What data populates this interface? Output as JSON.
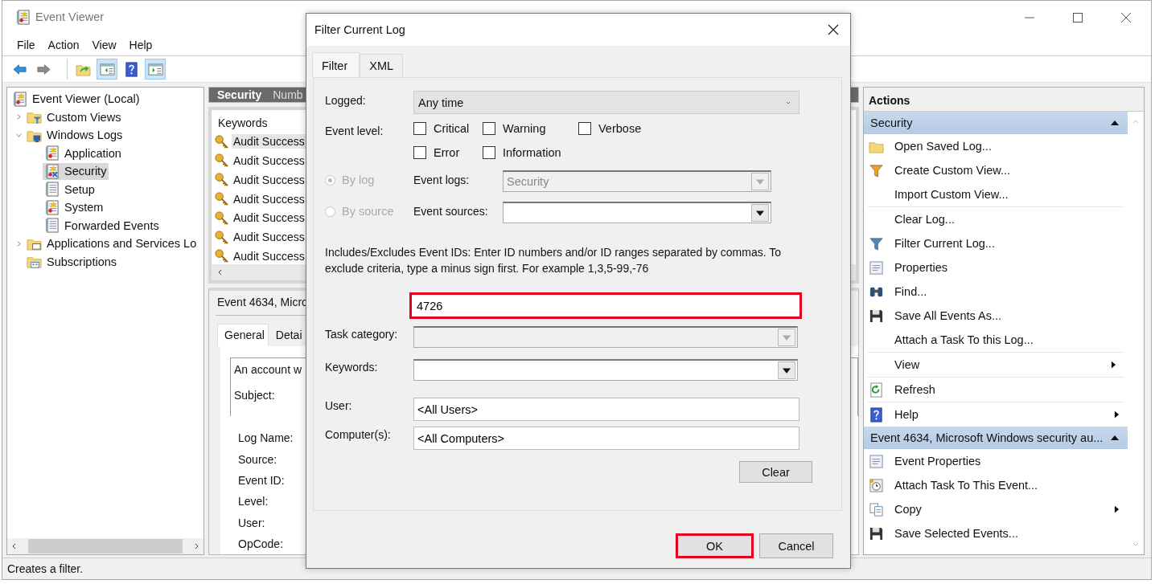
{
  "window": {
    "title": "Event Viewer"
  },
  "menu": [
    "File",
    "Action",
    "View",
    "Help"
  ],
  "toolbar": [
    {
      "kind": "back",
      "pressed": false
    },
    {
      "kind": "forward",
      "pressed": false
    },
    {
      "kind": "up",
      "pressed": false
    },
    {
      "kind": "tree",
      "pressed": true
    },
    {
      "kind": "help",
      "pressed": false
    },
    {
      "kind": "actions",
      "pressed": true
    }
  ],
  "tree": [
    {
      "label": "Event Viewer (Local)",
      "kind": "root",
      "selected": false,
      "children": [
        {
          "label": "Custom Views",
          "kind": "folder-filter",
          "expanded": false,
          "selected": false
        },
        {
          "label": "Windows Logs",
          "kind": "folder-logs",
          "expanded": true,
          "selected": false,
          "children": [
            {
              "label": "Application",
              "kind": "log-alert",
              "selected": false
            },
            {
              "label": "Security",
              "kind": "log-security",
              "selected": true
            },
            {
              "label": "Setup",
              "kind": "log-plain",
              "selected": false
            },
            {
              "label": "System",
              "kind": "log-alert",
              "selected": false
            },
            {
              "label": "Forwarded Events",
              "kind": "log-plain",
              "selected": false
            }
          ]
        },
        {
          "label": "Applications and Services Lo",
          "kind": "folder-window",
          "expanded": false,
          "selected": false
        },
        {
          "label": "Subscriptions",
          "kind": "folder-subscription",
          "selected": false
        }
      ]
    }
  ],
  "middle": {
    "header": {
      "title": "Security",
      "column": "Numb"
    },
    "list": {
      "column": "Keywords",
      "rows": [
        {
          "text": "Audit Success",
          "selected": true
        },
        {
          "text": "Audit Success",
          "selected": false
        },
        {
          "text": "Audit Success",
          "selected": false
        },
        {
          "text": "Audit Success",
          "selected": false
        },
        {
          "text": "Audit Success",
          "selected": false
        },
        {
          "text": "Audit Success",
          "selected": false
        },
        {
          "text": "Audit Success",
          "selected": false
        }
      ]
    },
    "details": {
      "title": "Event 4634, Micro",
      "tabs": [
        {
          "label": "General",
          "selected": true
        },
        {
          "label": "Detai",
          "selected": false
        }
      ],
      "message": [
        "An account w",
        "Subject:"
      ],
      "fields": [
        "Log Name:",
        "Source:",
        "Event ID:",
        "Level:",
        "User:",
        "OpCode:"
      ]
    }
  },
  "dialog": {
    "title": "Filter Current Log",
    "tabs": [
      {
        "label": "Filter",
        "selected": true
      },
      {
        "label": "XML",
        "selected": false
      }
    ],
    "logged": {
      "label": "Logged:",
      "value": "Any time"
    },
    "event_level": {
      "label": "Event level:",
      "options": [
        {
          "label": "Critical",
          "checked": false
        },
        {
          "label": "Warning",
          "checked": false
        },
        {
          "label": "Verbose",
          "checked": false
        },
        {
          "label": "Error",
          "checked": false
        },
        {
          "label": "Information",
          "checked": false
        }
      ]
    },
    "sources": [
      {
        "radio": "By log",
        "selected": true,
        "disabled": true,
        "label": "Event logs:",
        "value": "Security",
        "field_disabled": true
      },
      {
        "radio": "By source",
        "selected": false,
        "disabled": true,
        "label": "Event sources:",
        "field_disabled": false
      }
    ],
    "ids_help": "Includes/Excludes Event IDs: Enter ID numbers and/or ID ranges separated by commas. To exclude criteria, type a minus sign first. For example 1,3,5-99,-76",
    "ids": {
      "value": "4726",
      "highlighted": true
    },
    "task_category": {
      "label": "Task category:",
      "disabled": true
    },
    "keywords": {
      "label": "Keywords:",
      "disabled": false
    },
    "user": {
      "label": "User:",
      "value": "<All Users>"
    },
    "computers": {
      "label": "Computer(s):",
      "value": "<All Computers>"
    },
    "clear": "Clear",
    "buttons": [
      {
        "label": "OK",
        "highlighted": true
      },
      {
        "label": "Cancel",
        "highlighted": false
      }
    ]
  },
  "actions": {
    "title": "Actions",
    "groups": [
      {
        "title": "Security",
        "expanded": true,
        "items": [
          {
            "label": "Open Saved Log...",
            "kind": "open-folder",
            "submenu": false,
            "divider_after": false
          },
          {
            "label": "Create Custom View...",
            "kind": "funnel-color",
            "submenu": false,
            "divider_after": false
          },
          {
            "label": "Import Custom View...",
            "kind": "none",
            "submenu": false,
            "divider_after": true
          },
          {
            "label": "Clear Log...",
            "kind": "none",
            "submenu": false,
            "divider_after": false
          },
          {
            "label": "Filter Current Log...",
            "kind": "funnel",
            "submenu": false,
            "divider_after": false
          },
          {
            "label": "Properties",
            "kind": "sheet",
            "submenu": false,
            "divider_after": false
          },
          {
            "label": "Find...",
            "kind": "binoculars",
            "submenu": false,
            "divider_after": false
          },
          {
            "label": "Save All Events As...",
            "kind": "floppy",
            "submenu": false,
            "divider_after": false
          },
          {
            "label": "Attach a Task To this Log...",
            "kind": "none",
            "submenu": false,
            "divider_after": true
          },
          {
            "label": "View",
            "kind": "none",
            "submenu": true,
            "divider_after": true
          },
          {
            "label": "Refresh",
            "kind": "refresh",
            "submenu": false,
            "divider_after": true
          },
          {
            "label": "Help",
            "kind": "help",
            "submenu": true,
            "divider_after": false
          }
        ]
      },
      {
        "title": "Event 4634, Microsoft Windows security au...",
        "expanded": true,
        "items": [
          {
            "label": "Event Properties",
            "kind": "sheet",
            "submenu": false,
            "divider_after": false
          },
          {
            "label": "Attach Task To This Event...",
            "kind": "clock",
            "submenu": false,
            "divider_after": false
          },
          {
            "label": "Copy",
            "kind": "copy",
            "submenu": true,
            "divider_after": false
          },
          {
            "label": "Save Selected Events...",
            "kind": "floppy",
            "submenu": false,
            "divider_after": false
          }
        ]
      }
    ]
  },
  "status_bar": "Creates a filter."
}
